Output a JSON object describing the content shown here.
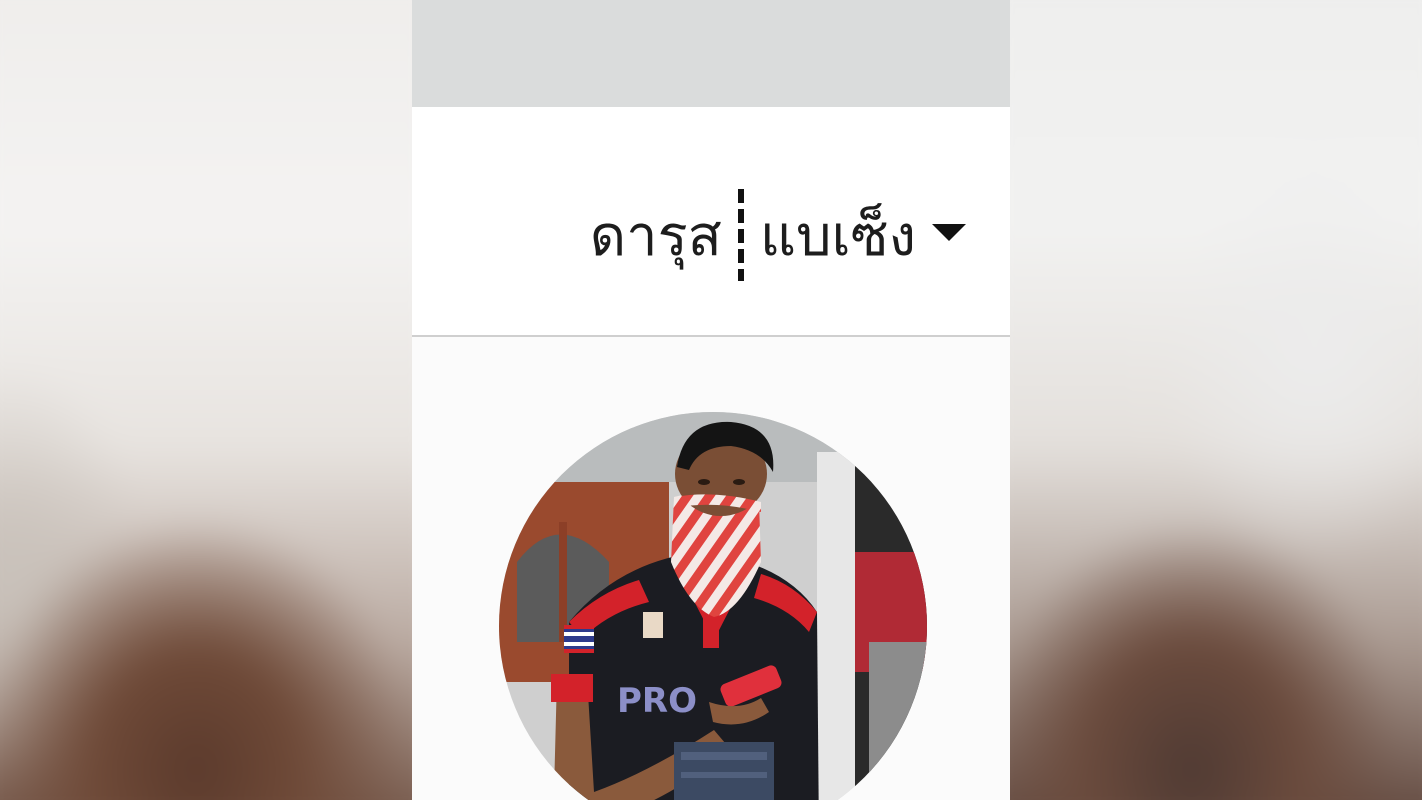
{
  "profile": {
    "first_name": "ดารุส",
    "last_name": "แบเซ็ง",
    "switcher_icon": "caret-down-icon",
    "avatar_alt": "profile photo"
  },
  "colors": {
    "topbar": "#dadcdc",
    "header_bg": "#ffffff",
    "text": "#1d1d1d",
    "divider": "#cfcfcf"
  }
}
